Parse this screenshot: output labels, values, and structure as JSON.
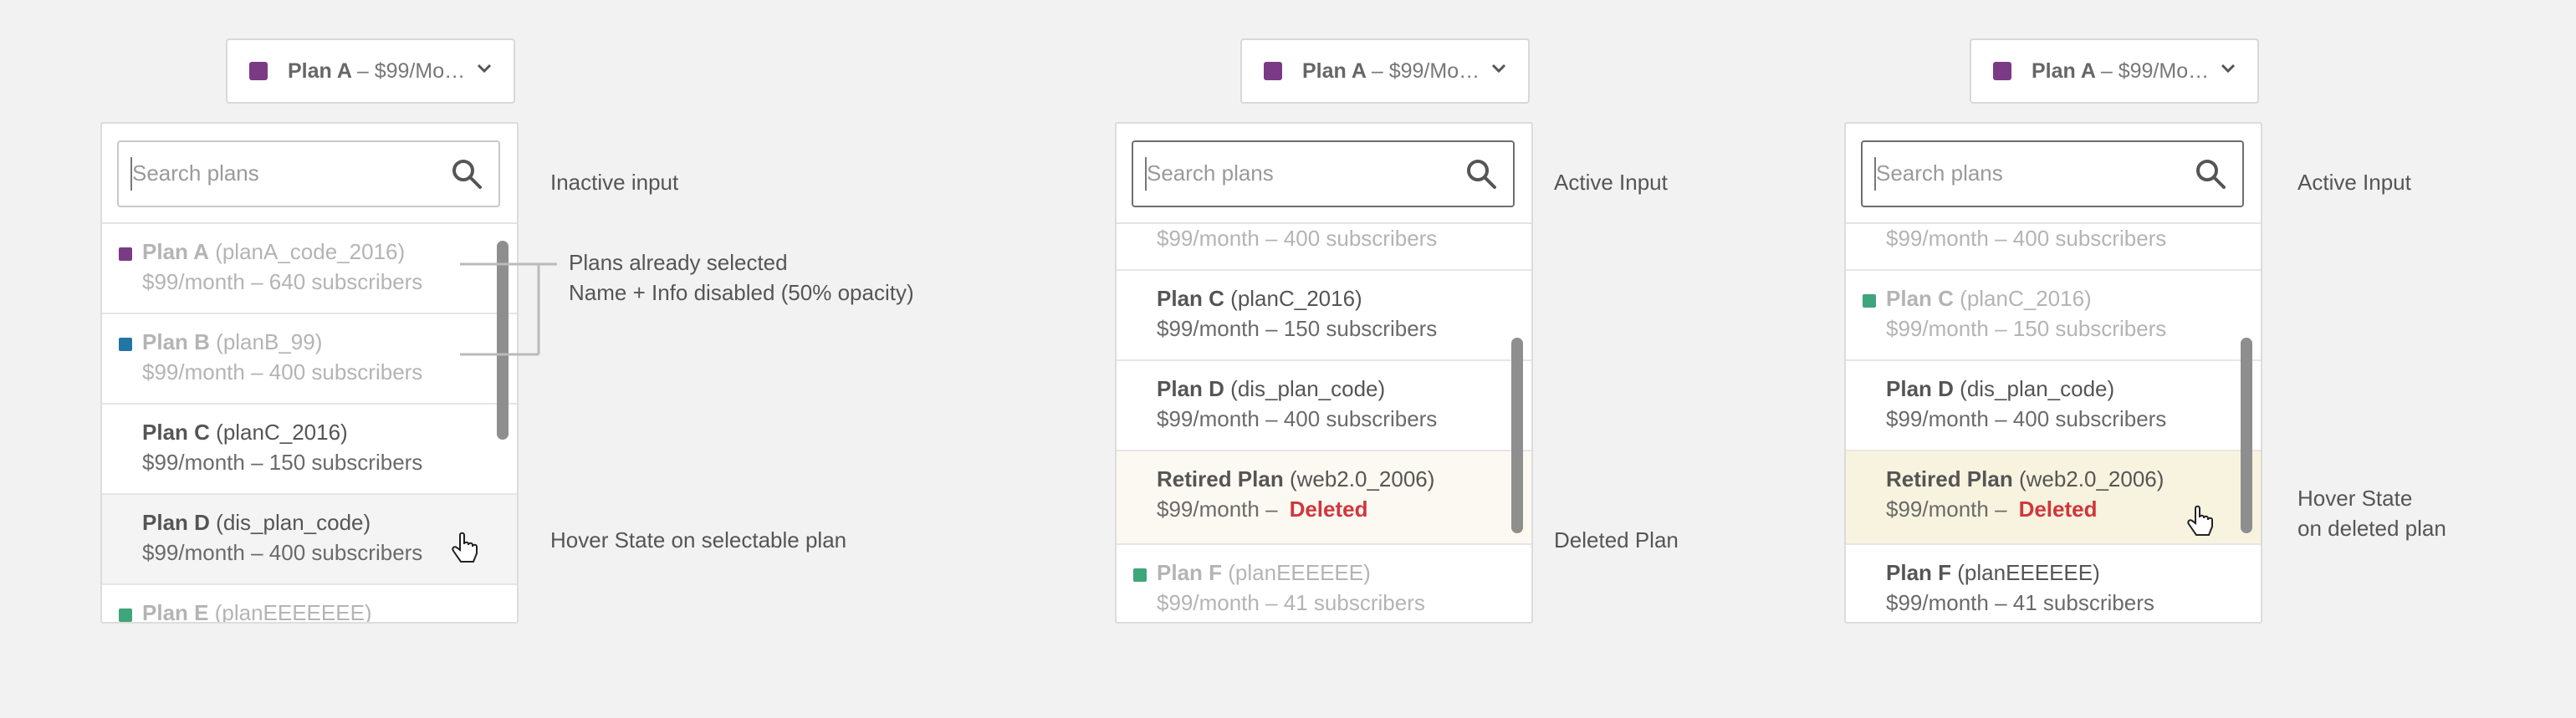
{
  "trigger": {
    "name": "Plan A",
    "price": "– $99/Mo…"
  },
  "colors": {
    "planA": "#7a3a85",
    "planB": "#2276a5",
    "planC": "#3fa57a",
    "planE": "#3fa57a",
    "planF": "#3fa57a",
    "deleted": "#d0363c"
  },
  "search": {
    "placeholder": "Search plans"
  },
  "plans": {
    "a": {
      "name": "Plan A",
      "code": "(planA_code_2016)",
      "info": "$99/month – 640 subscribers"
    },
    "b": {
      "name": "Plan B",
      "code": "(planB_99)",
      "info": "$99/month – 400 subscribers"
    },
    "c": {
      "name": "Plan C",
      "code": "(planC_2016)",
      "info": "$99/month – 150 subscribers"
    },
    "d": {
      "name": "Plan D",
      "code": "(dis_plan_code)",
      "info": "$99/month – 400 subscribers"
    },
    "e": {
      "name": "Plan E",
      "code": "(planEEEEEEE)"
    },
    "retired": {
      "name": "Retired Plan",
      "code": "(web2.0_2006)",
      "info": "$99/month –",
      "status": "Deleted"
    },
    "f": {
      "name": "Plan F",
      "code": "(planEEEEEE)",
      "info": "$99/month – 41 subscribers"
    }
  },
  "notes": {
    "inactive_input": "Inactive input",
    "already_selected_1": "Plans already selected",
    "already_selected_2": "Name + Info disabled (50% opacity)",
    "hover_selectable": "Hover State on selectable plan",
    "active_input": "Active Input",
    "deleted_plan": "Deleted Plan",
    "hover_deleted_1": "Hover State",
    "hover_deleted_2": "on deleted plan"
  }
}
